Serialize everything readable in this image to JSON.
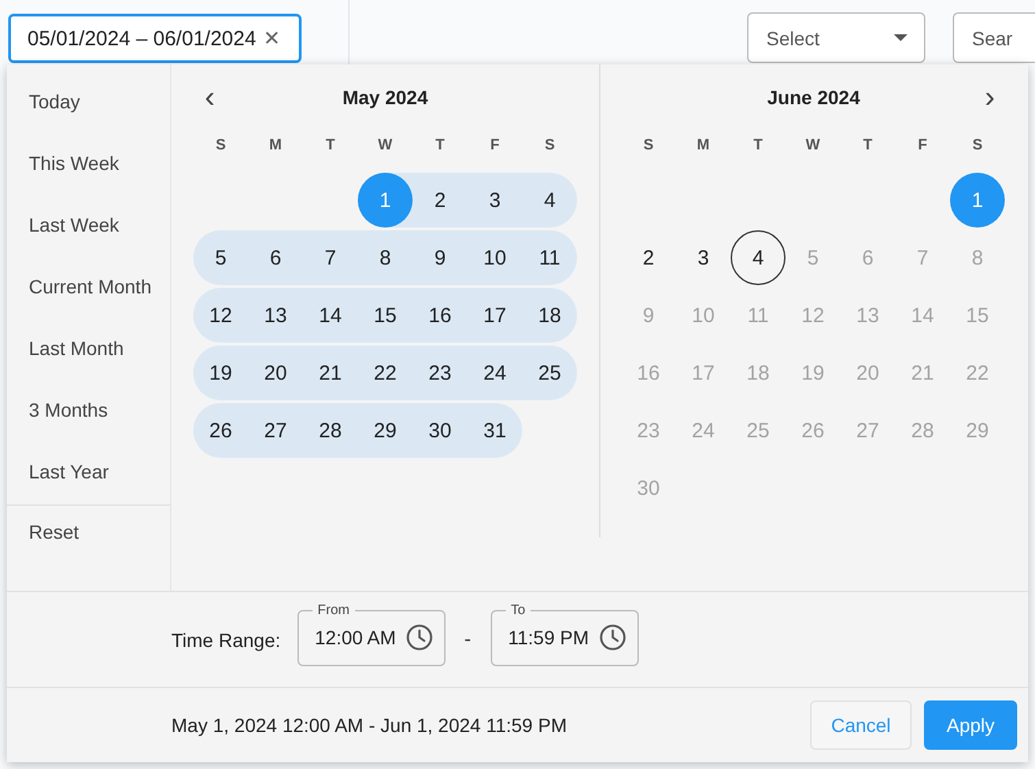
{
  "date_field": {
    "value": "05/01/2024 – 06/01/2024",
    "clear": "✕"
  },
  "select": {
    "placeholder": "Select"
  },
  "search_button": {
    "label": "Sear"
  },
  "presets": [
    {
      "label": "Today"
    },
    {
      "label": "This Week"
    },
    {
      "label": "Last Week"
    },
    {
      "label": "Current Month"
    },
    {
      "label": "Last Month"
    },
    {
      "label": "3 Months"
    },
    {
      "label": "Last Year"
    }
  ],
  "reset": "Reset",
  "nav": {
    "prev": "‹",
    "next": "›"
  },
  "months": [
    {
      "title": "May 2024",
      "weekdays": [
        "S",
        "M",
        "T",
        "W",
        "T",
        "F",
        "S"
      ],
      "weeks": [
        [
          {
            "kind": "blank"
          },
          {
            "kind": "blank"
          },
          {
            "kind": "blank"
          },
          {
            "kind": "day",
            "day": "1",
            "selected": true,
            "in_range": true,
            "muted": false,
            "today": false
          },
          {
            "kind": "day",
            "day": "2",
            "selected": false,
            "in_range": true,
            "muted": false,
            "today": false
          },
          {
            "kind": "day",
            "day": "3",
            "selected": false,
            "in_range": true,
            "muted": false,
            "today": false
          },
          {
            "kind": "day",
            "day": "4",
            "selected": false,
            "in_range": true,
            "muted": false,
            "today": false
          }
        ],
        [
          {
            "kind": "day",
            "day": "5",
            "selected": false,
            "in_range": true,
            "muted": false,
            "today": false
          },
          {
            "kind": "day",
            "day": "6",
            "selected": false,
            "in_range": true,
            "muted": false,
            "today": false
          },
          {
            "kind": "day",
            "day": "7",
            "selected": false,
            "in_range": true,
            "muted": false,
            "today": false
          },
          {
            "kind": "day",
            "day": "8",
            "selected": false,
            "in_range": true,
            "muted": false,
            "today": false
          },
          {
            "kind": "day",
            "day": "9",
            "selected": false,
            "in_range": true,
            "muted": false,
            "today": false
          },
          {
            "kind": "day",
            "day": "10",
            "selected": false,
            "in_range": true,
            "muted": false,
            "today": false
          },
          {
            "kind": "day",
            "day": "11",
            "selected": false,
            "in_range": true,
            "muted": false,
            "today": false
          }
        ],
        [
          {
            "kind": "day",
            "day": "12",
            "selected": false,
            "in_range": true,
            "muted": false,
            "today": false
          },
          {
            "kind": "day",
            "day": "13",
            "selected": false,
            "in_range": true,
            "muted": false,
            "today": false
          },
          {
            "kind": "day",
            "day": "14",
            "selected": false,
            "in_range": true,
            "muted": false,
            "today": false
          },
          {
            "kind": "day",
            "day": "15",
            "selected": false,
            "in_range": true,
            "muted": false,
            "today": false
          },
          {
            "kind": "day",
            "day": "16",
            "selected": false,
            "in_range": true,
            "muted": false,
            "today": false
          },
          {
            "kind": "day",
            "day": "17",
            "selected": false,
            "in_range": true,
            "muted": false,
            "today": false
          },
          {
            "kind": "day",
            "day": "18",
            "selected": false,
            "in_range": true,
            "muted": false,
            "today": false
          }
        ],
        [
          {
            "kind": "day",
            "day": "19",
            "selected": false,
            "in_range": true,
            "muted": false,
            "today": false
          },
          {
            "kind": "day",
            "day": "20",
            "selected": false,
            "in_range": true,
            "muted": false,
            "today": false
          },
          {
            "kind": "day",
            "day": "21",
            "selected": false,
            "in_range": true,
            "muted": false,
            "today": false
          },
          {
            "kind": "day",
            "day": "22",
            "selected": false,
            "in_range": true,
            "muted": false,
            "today": false
          },
          {
            "kind": "day",
            "day": "23",
            "selected": false,
            "in_range": true,
            "muted": false,
            "today": false
          },
          {
            "kind": "day",
            "day": "24",
            "selected": false,
            "in_range": true,
            "muted": false,
            "today": false
          },
          {
            "kind": "day",
            "day": "25",
            "selected": false,
            "in_range": true,
            "muted": false,
            "today": false
          }
        ],
        [
          {
            "kind": "day",
            "day": "26",
            "selected": false,
            "in_range": true,
            "muted": false,
            "today": false
          },
          {
            "kind": "day",
            "day": "27",
            "selected": false,
            "in_range": true,
            "muted": false,
            "today": false
          },
          {
            "kind": "day",
            "day": "28",
            "selected": false,
            "in_range": true,
            "muted": false,
            "today": false
          },
          {
            "kind": "day",
            "day": "29",
            "selected": false,
            "in_range": true,
            "muted": false,
            "today": false
          },
          {
            "kind": "day",
            "day": "30",
            "selected": false,
            "in_range": true,
            "muted": false,
            "today": false
          },
          {
            "kind": "day",
            "day": "31",
            "selected": false,
            "in_range": true,
            "muted": false,
            "today": false
          },
          {
            "kind": "blank"
          }
        ]
      ]
    },
    {
      "title": "June 2024",
      "weekdays": [
        "S",
        "M",
        "T",
        "W",
        "T",
        "F",
        "S"
      ],
      "weeks": [
        [
          {
            "kind": "blank"
          },
          {
            "kind": "blank"
          },
          {
            "kind": "blank"
          },
          {
            "kind": "blank"
          },
          {
            "kind": "blank"
          },
          {
            "kind": "blank"
          },
          {
            "kind": "day",
            "day": "1",
            "selected": true,
            "in_range": false,
            "muted": false,
            "today": false
          }
        ],
        [
          {
            "kind": "day",
            "day": "2",
            "selected": false,
            "in_range": false,
            "muted": false,
            "today": false
          },
          {
            "kind": "day",
            "day": "3",
            "selected": false,
            "in_range": false,
            "muted": false,
            "today": false
          },
          {
            "kind": "day",
            "day": "4",
            "selected": false,
            "in_range": false,
            "muted": false,
            "today": true
          },
          {
            "kind": "day",
            "day": "5",
            "selected": false,
            "in_range": false,
            "muted": true,
            "today": false
          },
          {
            "kind": "day",
            "day": "6",
            "selected": false,
            "in_range": false,
            "muted": true,
            "today": false
          },
          {
            "kind": "day",
            "day": "7",
            "selected": false,
            "in_range": false,
            "muted": true,
            "today": false
          },
          {
            "kind": "day",
            "day": "8",
            "selected": false,
            "in_range": false,
            "muted": true,
            "today": false
          }
        ],
        [
          {
            "kind": "day",
            "day": "9",
            "selected": false,
            "in_range": false,
            "muted": true,
            "today": false
          },
          {
            "kind": "day",
            "day": "10",
            "selected": false,
            "in_range": false,
            "muted": true,
            "today": false
          },
          {
            "kind": "day",
            "day": "11",
            "selected": false,
            "in_range": false,
            "muted": true,
            "today": false
          },
          {
            "kind": "day",
            "day": "12",
            "selected": false,
            "in_range": false,
            "muted": true,
            "today": false
          },
          {
            "kind": "day",
            "day": "13",
            "selected": false,
            "in_range": false,
            "muted": true,
            "today": false
          },
          {
            "kind": "day",
            "day": "14",
            "selected": false,
            "in_range": false,
            "muted": true,
            "today": false
          },
          {
            "kind": "day",
            "day": "15",
            "selected": false,
            "in_range": false,
            "muted": true,
            "today": false
          }
        ],
        [
          {
            "kind": "day",
            "day": "16",
            "selected": false,
            "in_range": false,
            "muted": true,
            "today": false
          },
          {
            "kind": "day",
            "day": "17",
            "selected": false,
            "in_range": false,
            "muted": true,
            "today": false
          },
          {
            "kind": "day",
            "day": "18",
            "selected": false,
            "in_range": false,
            "muted": true,
            "today": false
          },
          {
            "kind": "day",
            "day": "19",
            "selected": false,
            "in_range": false,
            "muted": true,
            "today": false
          },
          {
            "kind": "day",
            "day": "20",
            "selected": false,
            "in_range": false,
            "muted": true,
            "today": false
          },
          {
            "kind": "day",
            "day": "21",
            "selected": false,
            "in_range": false,
            "muted": true,
            "today": false
          },
          {
            "kind": "day",
            "day": "22",
            "selected": false,
            "in_range": false,
            "muted": true,
            "today": false
          }
        ],
        [
          {
            "kind": "day",
            "day": "23",
            "selected": false,
            "in_range": false,
            "muted": true,
            "today": false
          },
          {
            "kind": "day",
            "day": "24",
            "selected": false,
            "in_range": false,
            "muted": true,
            "today": false
          },
          {
            "kind": "day",
            "day": "25",
            "selected": false,
            "in_range": false,
            "muted": true,
            "today": false
          },
          {
            "kind": "day",
            "day": "26",
            "selected": false,
            "in_range": false,
            "muted": true,
            "today": false
          },
          {
            "kind": "day",
            "day": "27",
            "selected": false,
            "in_range": false,
            "muted": true,
            "today": false
          },
          {
            "kind": "day",
            "day": "28",
            "selected": false,
            "in_range": false,
            "muted": true,
            "today": false
          },
          {
            "kind": "day",
            "day": "29",
            "selected": false,
            "in_range": false,
            "muted": true,
            "today": false
          }
        ],
        [
          {
            "kind": "day",
            "day": "30",
            "selected": false,
            "in_range": false,
            "muted": true,
            "today": false
          },
          {
            "kind": "blank"
          },
          {
            "kind": "blank"
          },
          {
            "kind": "blank"
          },
          {
            "kind": "blank"
          },
          {
            "kind": "blank"
          },
          {
            "kind": "blank"
          }
        ]
      ]
    }
  ],
  "time_range": {
    "label": "Time Range:",
    "from": {
      "label": "From",
      "value": "12:00 AM"
    },
    "separator": "-",
    "to": {
      "label": "To",
      "value": "11:59 PM"
    }
  },
  "summary": "May 1, 2024 12:00 AM - Jun 1, 2024 11:59 PM",
  "buttons": {
    "cancel": "Cancel",
    "apply": "Apply"
  }
}
